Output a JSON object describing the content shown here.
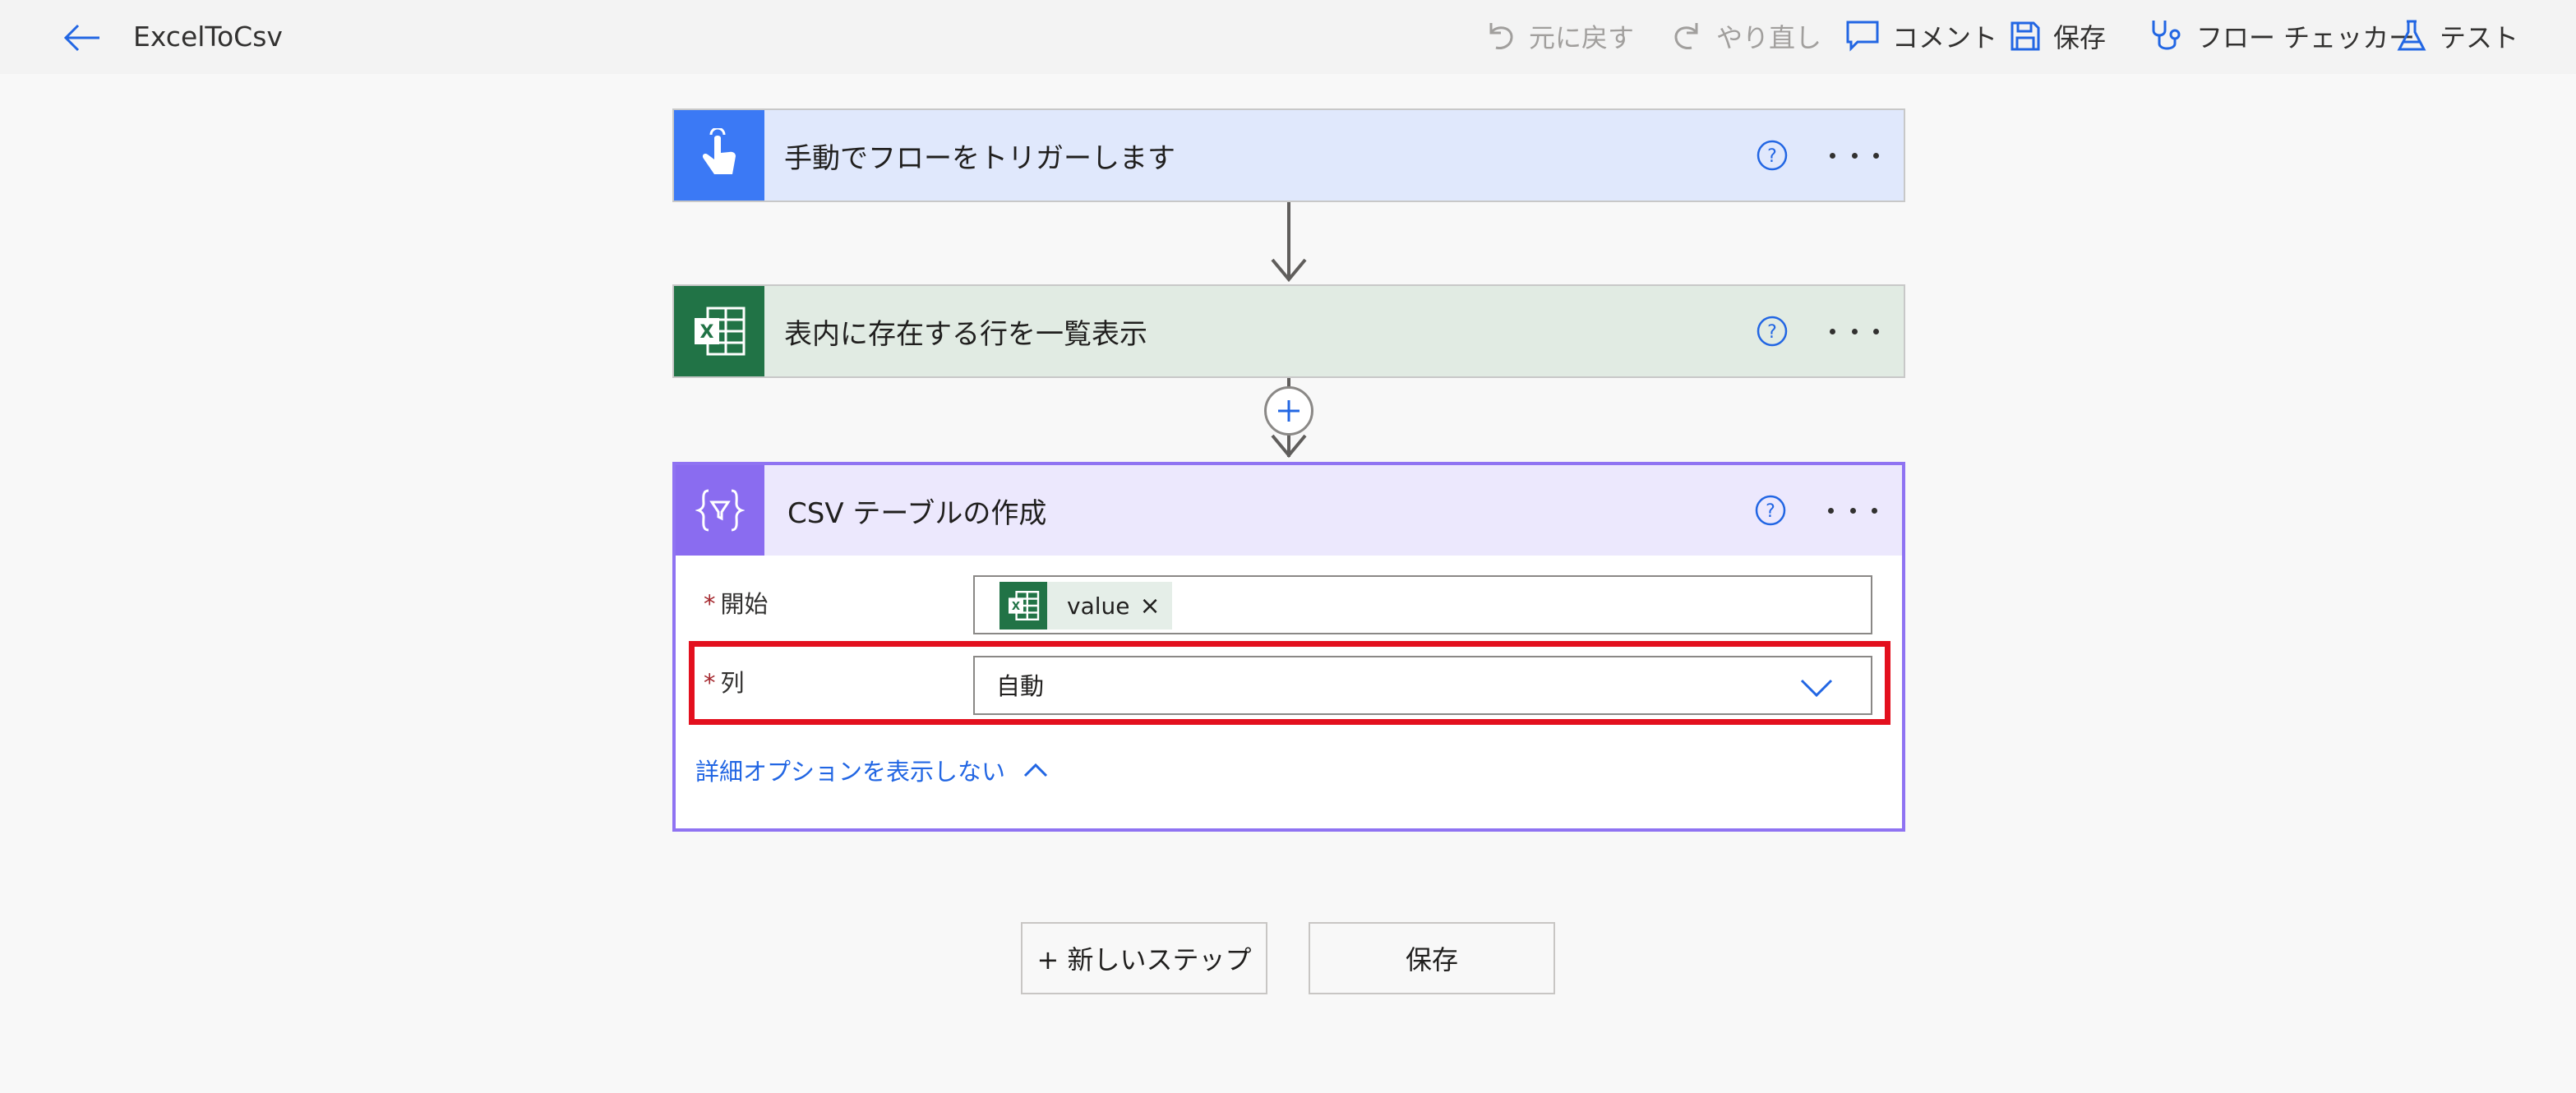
{
  "app": {
    "title": "ExcelToCsv"
  },
  "toolbar": {
    "undo_label": "元に戻す",
    "redo_label": "やり直し",
    "comment_label": "コメント",
    "save_label": "保存",
    "flow_checker_label": "フロー チェッカー",
    "test_label": "テスト"
  },
  "steps": {
    "trigger": {
      "title": "手動でフローをトリガーします",
      "icon": "touch-hand-icon"
    },
    "list_rows": {
      "title": "表内に存在する行を一覧表示",
      "icon": "excel-icon"
    },
    "csv_table": {
      "title": "CSV テーブルの作成",
      "icon": "data-operation-icon",
      "fields": {
        "from": {
          "label": "開始",
          "required_mark": "*",
          "token": "value"
        },
        "columns": {
          "label": "列",
          "required_mark": "*",
          "value": "自動"
        }
      },
      "advanced_toggle_label": "詳細オプションを表示しない"
    }
  },
  "bottom": {
    "new_step_label": "+ 新しいステップ",
    "save_label": "保存"
  },
  "colors": {
    "trigger_accent": "#3b79f5",
    "excel_accent": "#217346",
    "csv_accent": "#8a6cf0",
    "highlight": "#e3101e",
    "link": "#2266e3"
  }
}
